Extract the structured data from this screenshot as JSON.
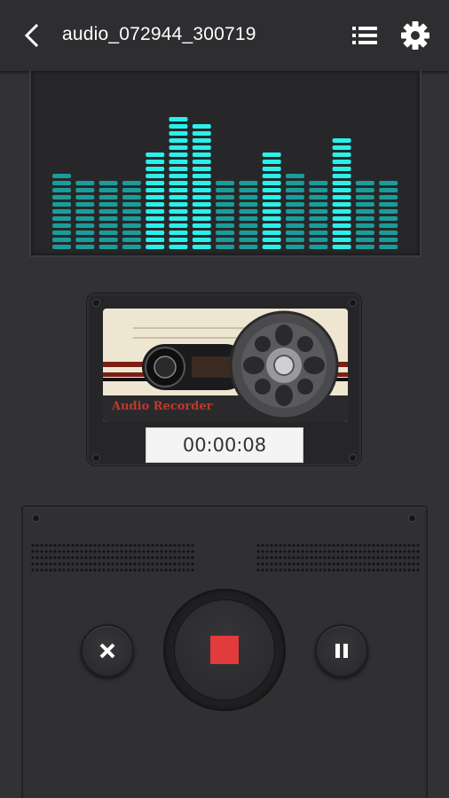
{
  "header": {
    "title": "audio_072944_300719",
    "back_icon": "chevron-left-icon",
    "list_icon": "list-icon",
    "settings_icon": "gear-icon"
  },
  "visualizer": {
    "levels": [
      0.43,
      0.37,
      0.37,
      0.37,
      0.53,
      0.74,
      0.7,
      0.37,
      0.37,
      0.55,
      0.43,
      0.4,
      0.62,
      0.37,
      0.4
    ],
    "bright_color": "#2af0ea",
    "dim_color": "#1a9d9a"
  },
  "cassette": {
    "label": "Audio Recorder",
    "elapsed_time": "00:00:08"
  },
  "controls": {
    "cancel_icon": "close-icon",
    "stop_icon": "stop-icon",
    "pause_icon": "pause-icon",
    "stop_color": "#e23b3b"
  }
}
